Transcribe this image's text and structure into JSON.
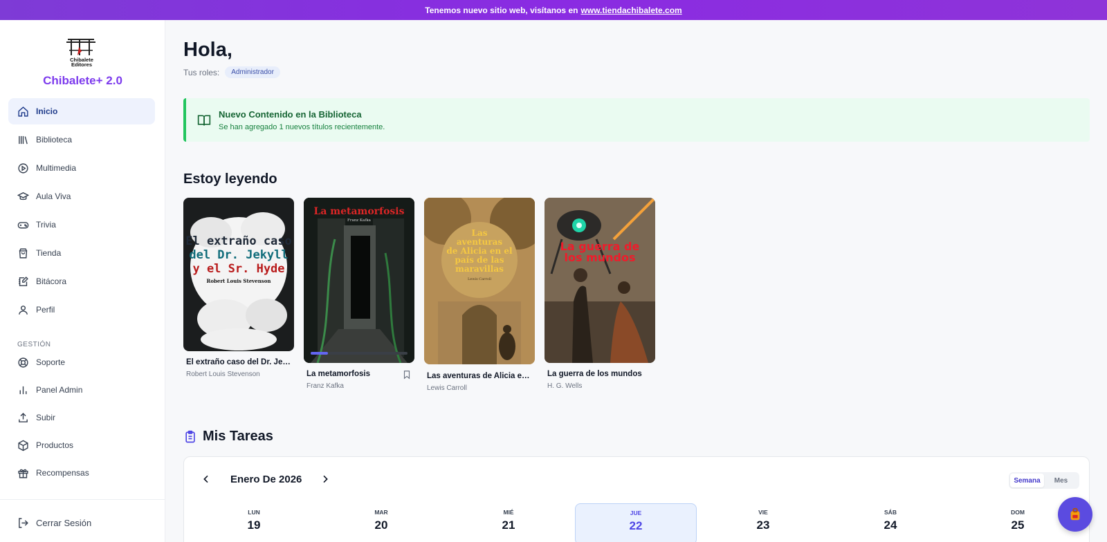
{
  "banner": {
    "text": "Tenemos nuevo sitio web, visítanos en",
    "link": "www.tiendachibalete.com"
  },
  "sidebar": {
    "logo_text": "Chibalete Editores",
    "brand": "Chibalete+ 2.0",
    "items": [
      {
        "label": "Inicio",
        "icon": "home-icon"
      },
      {
        "label": "Biblioteca",
        "icon": "library-icon"
      },
      {
        "label": "Multimedia",
        "icon": "play-circle-icon"
      },
      {
        "label": "Aula Viva",
        "icon": "graduation-cap-icon"
      },
      {
        "label": "Trivia",
        "icon": "gamepad-icon"
      },
      {
        "label": "Tienda",
        "icon": "shopping-bag-icon"
      },
      {
        "label": "Bitácora",
        "icon": "notebook-pen-icon"
      },
      {
        "label": "Perfil",
        "icon": "user-icon"
      }
    ],
    "section_label": "GESTIÓN",
    "admin_items": [
      {
        "label": "Soporte",
        "icon": "lifebuoy-icon"
      },
      {
        "label": "Panel Admin",
        "icon": "bar-chart-icon"
      },
      {
        "label": "Subir",
        "icon": "upload-icon"
      },
      {
        "label": "Productos",
        "icon": "package-icon"
      },
      {
        "label": "Recompensas",
        "icon": "gift-icon"
      }
    ],
    "logout": "Cerrar Sesión"
  },
  "main": {
    "greeting": "Hola,",
    "roles_label": "Tus roles:",
    "role": "Administrador",
    "notice": {
      "title": "Nuevo Contenido en la Biblioteca",
      "body": "Se han agregado 1 nuevos títulos recientemente."
    },
    "reading_title": "Estoy leyendo",
    "books": [
      {
        "title": "El extraño caso del Dr. Jekyll y el Sr. Hyde",
        "author": "Robert Louis Stevenson",
        "cover_lines": [
          "El extraño caso",
          "del Dr. Jekyll",
          "y el Sr. Hyde"
        ],
        "cover_author": "Robert Louis Stevenson"
      },
      {
        "title": "La metamorfosis",
        "author": "Franz Kafka",
        "cover_lines": [
          "La metamorfosis"
        ],
        "cover_author": "Franz Kafka",
        "progress": 0.18
      },
      {
        "title": "Las aventuras de Alicia en el país de las maravillas",
        "author": "Lewis Carroll",
        "cover_lines": [
          "Las",
          "aventuras",
          "de Alicia en el",
          "país de las",
          "maravillas"
        ],
        "cover_author": "Lewis Carroll"
      },
      {
        "title": "La guerra de los mundos",
        "author": "H. G. Wells",
        "cover_lines": [
          "La guerra de",
          "los mundos"
        ]
      }
    ],
    "tasks_title": "Mis Tareas",
    "calendar": {
      "month": "Enero De 2026",
      "view_week": "Semana",
      "view_month": "Mes",
      "days": [
        {
          "name": "LUN",
          "num": "19"
        },
        {
          "name": "MAR",
          "num": "20"
        },
        {
          "name": "MIÉ",
          "num": "21"
        },
        {
          "name": "JUE",
          "num": "22"
        },
        {
          "name": "VIE",
          "num": "23"
        },
        {
          "name": "SÁB",
          "num": "24"
        },
        {
          "name": "DOM",
          "num": "25"
        }
      ]
    }
  },
  "colors": {
    "accent": "#7c3aed",
    "active_nav": "#eef2fd",
    "notice_bg": "#eafbf1",
    "notice_border": "#22c55e",
    "today": "#4f46e5"
  }
}
